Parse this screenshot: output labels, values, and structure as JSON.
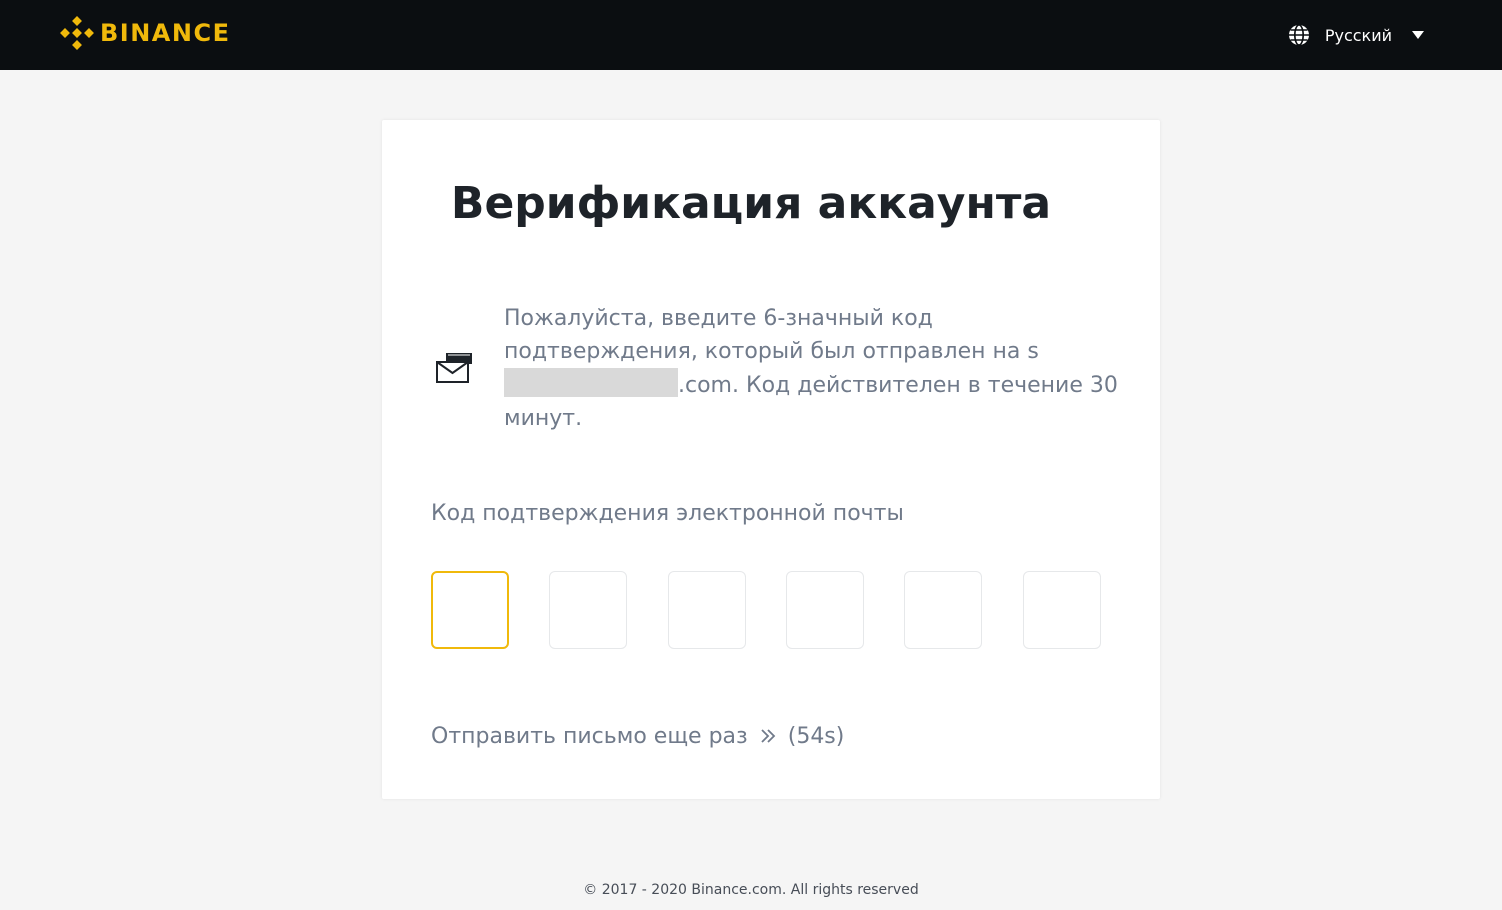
{
  "header": {
    "brand": "BINANCE",
    "logo_icon": "binance-diamond-logo",
    "brand_color": "#f0b90b",
    "language": {
      "icon": "globe-icon",
      "label": "Русский",
      "caret_icon": "caret-down-icon"
    }
  },
  "card": {
    "title": "Верификация аккаунта",
    "info": {
      "icon": "envelope-icon",
      "text_before": "Пожалуйста, введите 6-значный код подтверждения, который был отправлен на s",
      "text_after": ".com. Код действителен в течение 30 минут."
    },
    "code_field": {
      "label": "Код подтверждения электронной почты",
      "digits": [
        "",
        "",
        "",
        "",
        "",
        ""
      ],
      "active_index": 0,
      "active_color": "#f0b90b"
    },
    "resend": {
      "label": "Отправить письмо еще раз",
      "icon": "double-chevron-right-icon",
      "countdown": "(54s)"
    }
  },
  "footer": {
    "copyright": "© 2017 - 2020 Binance.com. All rights reserved"
  }
}
